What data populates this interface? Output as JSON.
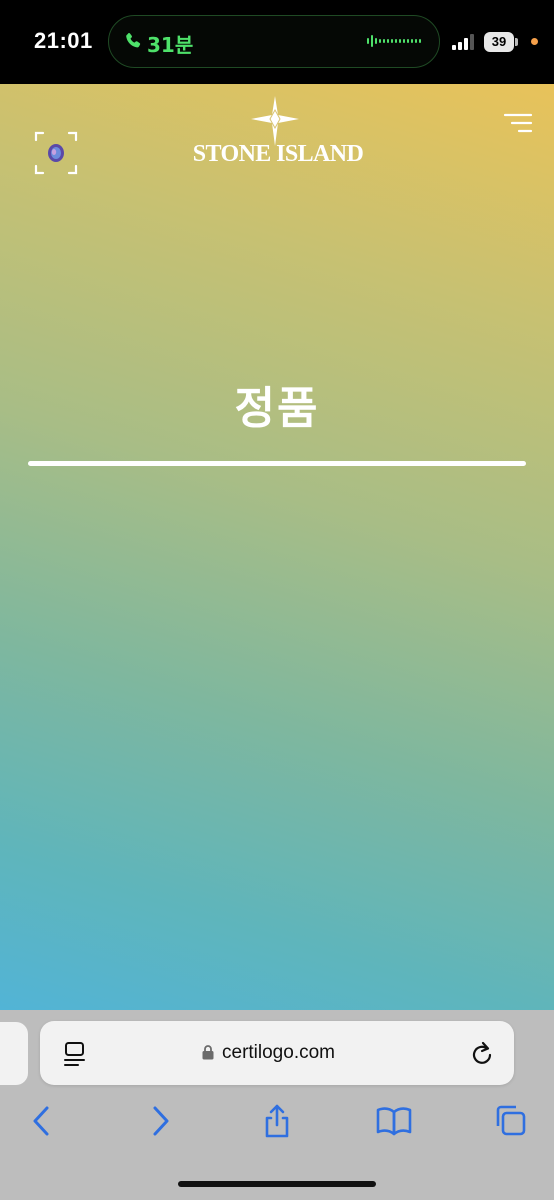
{
  "status_bar": {
    "time": "21:01",
    "call_label": "31분",
    "battery_level": "39",
    "accent_green": "#4ee16a",
    "indicator_color": "#f5a04a"
  },
  "site": {
    "brand_name": "STONE ISLAND",
    "heading": "정품",
    "scan_icon": "camera-scan-icon",
    "menu_icon": "hamburger-menu-icon",
    "gradient_colors": [
      "#e8c25a",
      "#a8bd86",
      "#52b4d6"
    ]
  },
  "browser": {
    "url": "certilogo.com",
    "reader_icon": "reader-view-icon",
    "lock_icon": "lock-icon",
    "reload_icon": "reload-icon",
    "toolbar_icons": [
      "back-icon",
      "forward-icon",
      "share-icon",
      "bookmarks-icon",
      "tabs-icon"
    ],
    "accent_blue": "#2f6fe0"
  }
}
